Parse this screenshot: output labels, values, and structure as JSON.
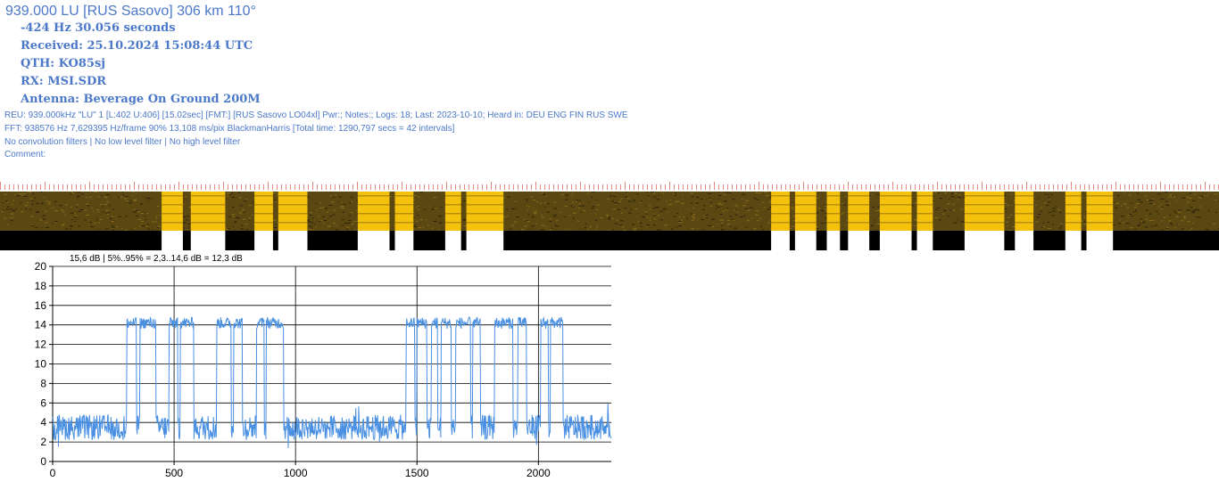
{
  "header": {
    "title": "939.000 LU [RUS Sasovo] 306 km 110°",
    "offset_line": "-424 Hz 30.056 seconds",
    "received": "Received: 25.10.2024 15:08:44 UTC",
    "qth": "QTH: KO85sj",
    "rx": "RX: MSI.SDR",
    "antenna": "Antenna: Beverage On Ground 200M"
  },
  "details": {
    "reu": "REU: 939.000kHz \"LU\" 1 [L:402 U:406] [15.02sec] [FMT:] [RUS Sasovo LO04xl] Pwr:; Notes:; Logs: 18; Last: 2023-10-10; Heard in: DEU ENG FIN RUS SWE",
    "fft": "FFT: 938576 Hz 7,629395 Hz/frame 90% 13,108 ms/pix BlackmanHarris [Total time: 1290,797 secs = 42 intervals]",
    "filters": "No convolution filters | No low level filter | No high level filter",
    "comment": "Comment:"
  },
  "colors": {
    "text": "#4b78c9",
    "signal_line": "#4a90e2",
    "spectro_on": "#f4c20d",
    "spectro_noise": "#5a4712",
    "bar_black": "#000000",
    "tick_red": "#d9534f"
  },
  "chart_data": {
    "type": "line",
    "title": "15,6 dB | 5%..95% = 2,3..14,6 dB = 12,3 dB",
    "xlabel": "",
    "ylabel": "",
    "xlim": [
      0,
      2300
    ],
    "ylim": [
      0,
      20
    ],
    "xticks": [
      0,
      500,
      1000,
      1500,
      2000
    ],
    "yticks": [
      0,
      2,
      4,
      6,
      8,
      10,
      12,
      14,
      16,
      18,
      20
    ],
    "grid": true,
    "baseline_level": 3.5,
    "on_level": 14.2,
    "on_segments": [
      [
        305,
        345
      ],
      [
        360,
        425
      ],
      [
        480,
        515
      ],
      [
        525,
        580
      ],
      [
        675,
        735
      ],
      [
        745,
        780
      ],
      [
        840,
        870
      ],
      [
        880,
        950
      ],
      [
        1455,
        1490
      ],
      [
        1500,
        1540
      ],
      [
        1560,
        1585
      ],
      [
        1600,
        1640
      ],
      [
        1660,
        1720
      ],
      [
        1730,
        1760
      ],
      [
        1820,
        1895
      ],
      [
        1915,
        1950
      ],
      [
        2010,
        2040
      ],
      [
        2050,
        2100
      ]
    ]
  }
}
